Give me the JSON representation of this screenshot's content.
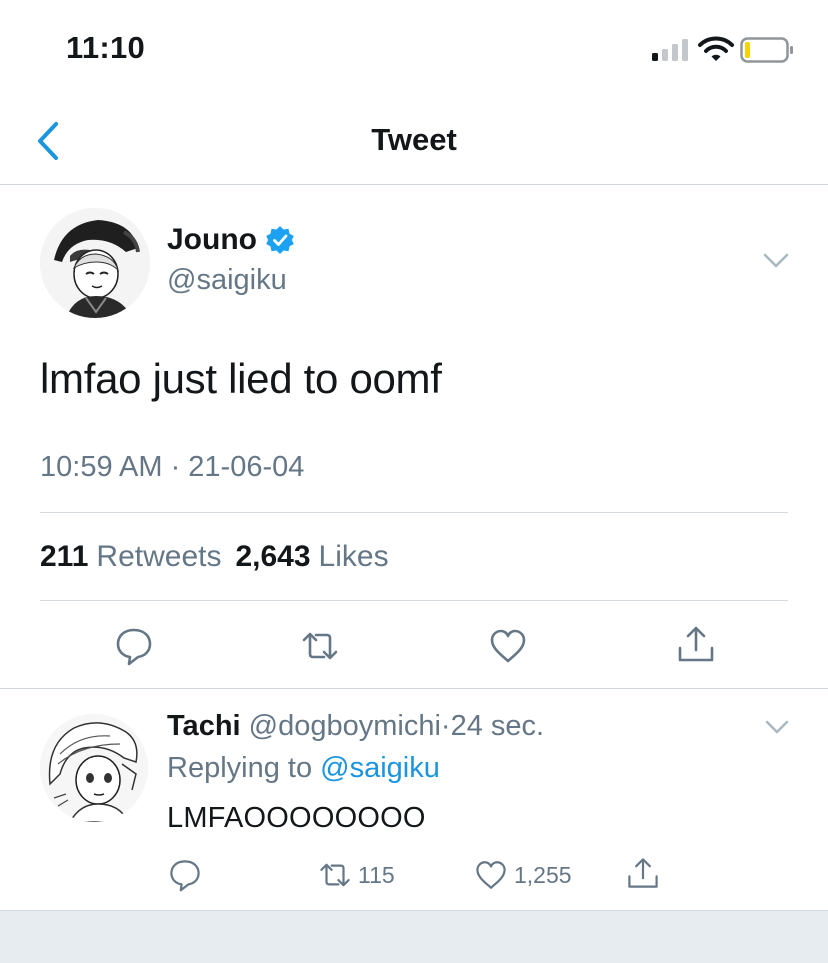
{
  "status_bar": {
    "time": "11:10"
  },
  "nav": {
    "title": "Tweet"
  },
  "tweet": {
    "display_name": "Jouno",
    "handle": "@saigiku",
    "text": "lmfao just lied to oomf",
    "timestamp": "10:59 AM · 21-06-04",
    "retweets_count": "211",
    "retweets_label": "Retweets",
    "likes_count": "2,643",
    "likes_label": "Likes"
  },
  "reply": {
    "display_name": "Tachi",
    "handle": "@dogboymichi",
    "separator": "·",
    "time_ago": "24 sec.",
    "replying_prefix": "Replying to",
    "replying_to": "@saigiku",
    "text": "LMFAOOOOOOOO",
    "retweet_count": "115",
    "like_count": "1,255"
  },
  "colors": {
    "accent": "#1b95e0",
    "secondary_text": "#657786",
    "divider": "#d6dbe0",
    "battery_level": "#f5d400"
  },
  "icons": {
    "back": "chevron-left-icon",
    "verified": "verified-badge-icon",
    "menu": "chevron-down-icon",
    "reply": "comment-icon",
    "retweet": "retweet-icon",
    "like": "heart-icon",
    "share": "share-icon"
  }
}
